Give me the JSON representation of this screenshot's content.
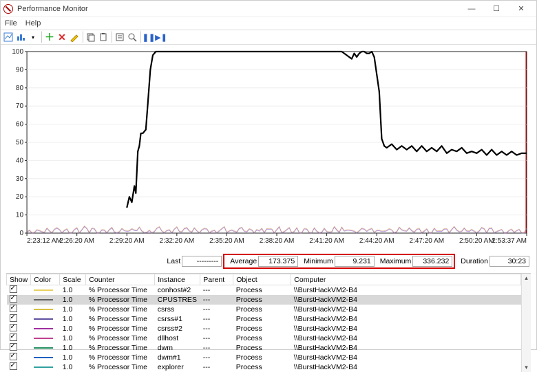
{
  "window": {
    "title": "Performance Monitor",
    "menu": {
      "file": "File",
      "help": "Help"
    },
    "buttons": {
      "min": "—",
      "max": "☐",
      "close": "✕"
    }
  },
  "chart_data": {
    "type": "line",
    "title": "",
    "xlabel": "",
    "ylabel": "",
    "ylim": [
      0,
      100
    ],
    "yticks": [
      0,
      10,
      20,
      30,
      40,
      50,
      60,
      70,
      80,
      90,
      100
    ],
    "x_categories": [
      "2:23:12 AM",
      "2:26:20 AM",
      "2:29:20 AM",
      "2:32:20 AM",
      "2:35:20 AM",
      "2:38:20 AM",
      "2:41:20 AM",
      "2:44:20 AM",
      "2:47:20 AM",
      "2:50:20 AM",
      "2:53:37 AM"
    ],
    "primary_series_name": "CPUSTRES % Processor Time",
    "primary_series": [
      [
        0.2,
        14
      ],
      [
        0.205,
        20
      ],
      [
        0.21,
        17
      ],
      [
        0.215,
        26
      ],
      [
        0.218,
        22
      ],
      [
        0.222,
        45
      ],
      [
        0.225,
        48
      ],
      [
        0.228,
        55
      ],
      [
        0.232,
        55
      ],
      [
        0.238,
        57
      ],
      [
        0.243,
        75
      ],
      [
        0.247,
        90
      ],
      [
        0.252,
        98
      ],
      [
        0.258,
        100
      ],
      [
        0.3,
        100
      ],
      [
        0.35,
        100
      ],
      [
        0.4,
        100
      ],
      [
        0.45,
        100
      ],
      [
        0.5,
        100
      ],
      [
        0.55,
        100
      ],
      [
        0.6,
        100
      ],
      [
        0.63,
        100
      ],
      [
        0.65,
        96
      ],
      [
        0.655,
        99
      ],
      [
        0.66,
        97
      ],
      [
        0.665,
        99
      ],
      [
        0.67,
        100
      ],
      [
        0.675,
        100
      ],
      [
        0.68,
        99
      ],
      [
        0.685,
        99
      ],
      [
        0.69,
        100
      ],
      [
        0.695,
        97
      ],
      [
        0.705,
        78
      ],
      [
        0.71,
        52
      ],
      [
        0.715,
        48
      ],
      [
        0.72,
        47
      ],
      [
        0.73,
        49
      ],
      [
        0.74,
        46
      ],
      [
        0.75,
        48
      ],
      [
        0.76,
        46
      ],
      [
        0.77,
        48
      ],
      [
        0.78,
        45
      ],
      [
        0.79,
        48
      ],
      [
        0.8,
        45
      ],
      [
        0.81,
        47
      ],
      [
        0.82,
        45
      ],
      [
        0.83,
        48
      ],
      [
        0.84,
        44
      ],
      [
        0.85,
        46
      ],
      [
        0.86,
        45
      ],
      [
        0.87,
        47
      ],
      [
        0.88,
        44
      ],
      [
        0.89,
        45
      ],
      [
        0.9,
        44
      ],
      [
        0.91,
        46
      ],
      [
        0.92,
        43
      ],
      [
        0.93,
        46
      ],
      [
        0.94,
        43
      ],
      [
        0.95,
        45
      ],
      [
        0.96,
        43
      ],
      [
        0.97,
        45
      ],
      [
        0.98,
        43
      ],
      [
        0.99,
        44
      ],
      [
        1.0,
        44
      ]
    ]
  },
  "stats": {
    "last_label": "Last",
    "last_value": "---------",
    "average_label": "Average",
    "average_value": "173.375",
    "minimum_label": "Minimum",
    "minimum_value": "9.231",
    "maximum_label": "Maximum",
    "maximum_value": "336.232",
    "duration_label": "Duration",
    "duration_value": "30:23"
  },
  "legend": {
    "headers": {
      "show": "Show",
      "color": "Color",
      "scale": "Scale",
      "counter": "Counter",
      "instance": "Instance",
      "parent": "Parent",
      "object": "Object",
      "computer": "Computer"
    },
    "rows": [
      {
        "color": "#e8d060",
        "scale": "1.0",
        "counter": "% Processor Time",
        "instance": "conhost#2",
        "parent": "---",
        "object": "Process",
        "computer": "\\\\BurstHackVM2-B4",
        "selected": false
      },
      {
        "color": "#606060",
        "scale": "1.0",
        "counter": "% Processor Time",
        "instance": "CPUSTRES",
        "parent": "---",
        "object": "Process",
        "computer": "\\\\BurstHackVM2-B4",
        "selected": true
      },
      {
        "color": "#d8c040",
        "scale": "1.0",
        "counter": "% Processor Time",
        "instance": "csrss",
        "parent": "---",
        "object": "Process",
        "computer": "\\\\BurstHackVM2-B4",
        "selected": false
      },
      {
        "color": "#6050a0",
        "scale": "1.0",
        "counter": "% Processor Time",
        "instance": "csrss#1",
        "parent": "---",
        "object": "Process",
        "computer": "\\\\BurstHackVM2-B4",
        "selected": false
      },
      {
        "color": "#a030a0",
        "scale": "1.0",
        "counter": "% Processor Time",
        "instance": "csrss#2",
        "parent": "---",
        "object": "Process",
        "computer": "\\\\BurstHackVM2-B4",
        "selected": false
      },
      {
        "color": "#c04090",
        "scale": "1.0",
        "counter": "% Processor Time",
        "instance": "dllhost",
        "parent": "---",
        "object": "Process",
        "computer": "\\\\BurstHackVM2-B4",
        "selected": false
      },
      {
        "color": "#209060",
        "scale": "1.0",
        "counter": "% Processor Time",
        "instance": "dwm",
        "parent": "---",
        "object": "Process",
        "computer": "\\\\BurstHackVM2-B4",
        "selected": false
      },
      {
        "color": "#2060c0",
        "scale": "1.0",
        "counter": "% Processor Time",
        "instance": "dwm#1",
        "parent": "---",
        "object": "Process",
        "computer": "\\\\BurstHackVM2-B4",
        "selected": false
      },
      {
        "color": "#30a0a0",
        "scale": "1.0",
        "counter": "% Processor Time",
        "instance": "explorer",
        "parent": "---",
        "object": "Process",
        "computer": "\\\\BurstHackVM2-B4",
        "selected": false
      }
    ]
  }
}
